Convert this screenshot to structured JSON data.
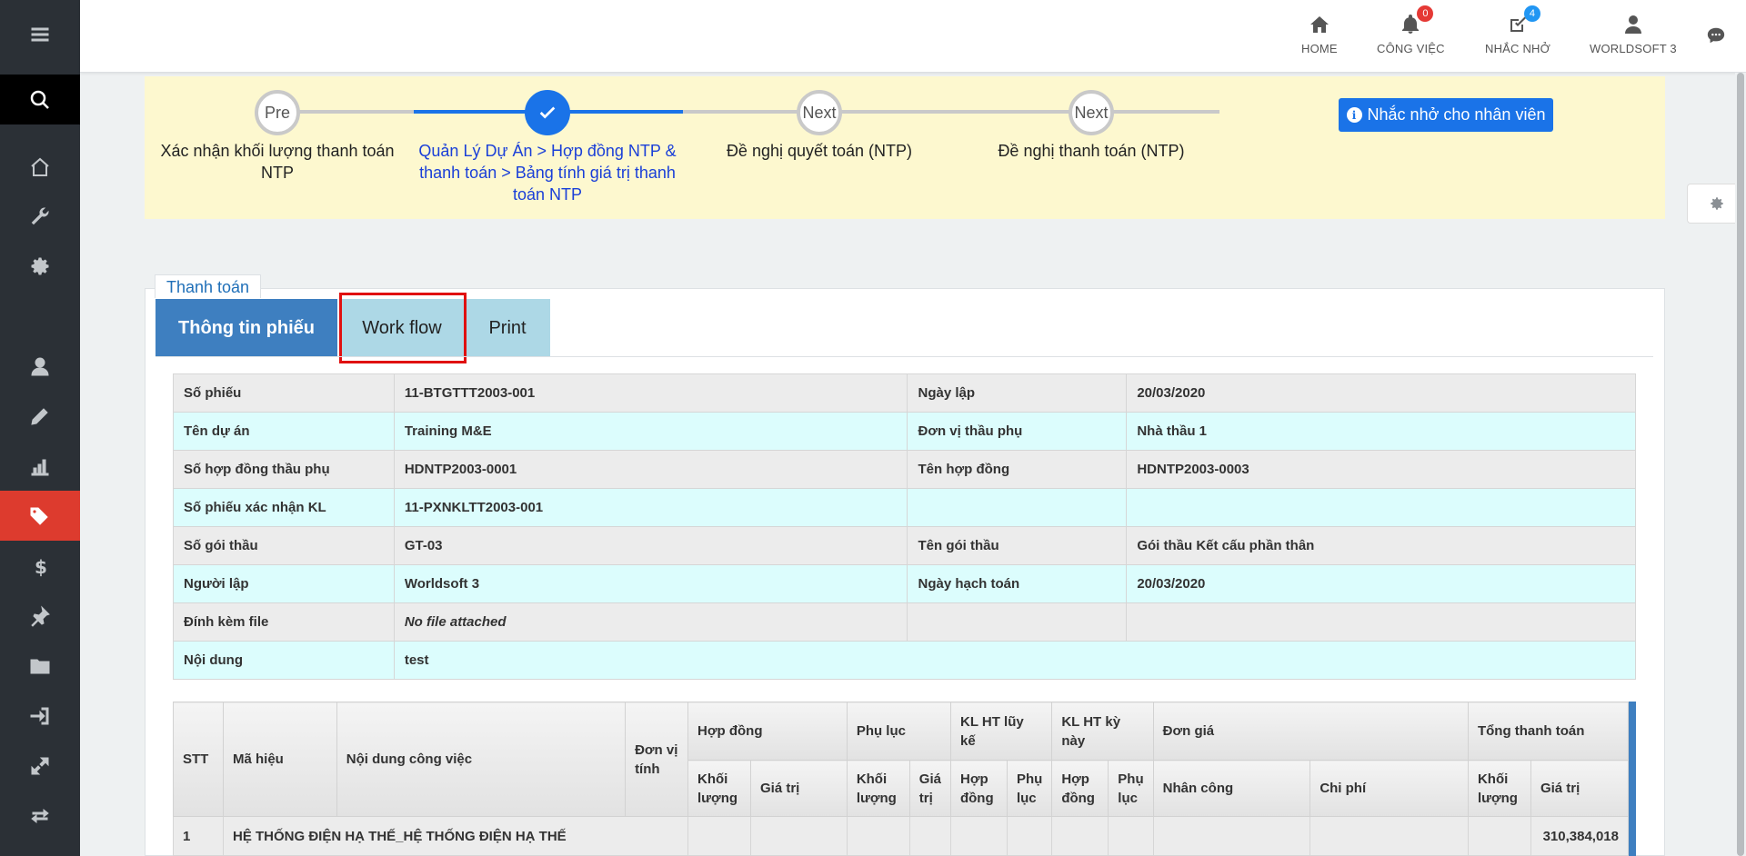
{
  "topbar": {
    "home": "HOME",
    "tasks": "CÔNG VIỆC",
    "tasks_badge": "0",
    "reminders": "NHẮC NHỞ",
    "reminders_badge": "4",
    "user": "WORLDSOFT 3"
  },
  "sidebar_icons": [
    "menu-icon",
    "search-icon",
    "home-icon",
    "wrench-icon",
    "gear-icon",
    "user-icon",
    "pencil-icon",
    "bar-chart-icon",
    "tags-icon",
    "dollar-icon",
    "pin-icon",
    "folder-icon",
    "sign-in-icon",
    "expand-icon",
    "exchange-icon"
  ],
  "workflow": {
    "steps": [
      {
        "node": "Pre",
        "label": "Xác nhận khối lượng thanh toán NTP"
      },
      {
        "node": "",
        "label": "Quản Lý Dự Án > Hợp đồng NTP & thanh toán > Bảng tính giá trị thanh toán NTP"
      },
      {
        "node": "Next",
        "label": "Đề nghị quyết toán (NTP)"
      },
      {
        "node": "Next",
        "label": "Đề nghị thanh toán (NTP)"
      }
    ],
    "remind_button": "Nhắc nhở cho nhân viên"
  },
  "panel": {
    "legend": "Thanh toán",
    "tabs": [
      "Thông tin phiếu",
      "Work flow",
      "Print"
    ]
  },
  "info": {
    "rows": [
      [
        "Số phiếu",
        "11-BTGTTT2003-001",
        "Ngày lập",
        "20/03/2020"
      ],
      [
        "Tên dự án",
        "Training M&E",
        "Đơn vị thầu phụ",
        "Nhà thầu 1"
      ],
      [
        "Số hợp đồng thầu phụ",
        "HDNTP2003-0001",
        "Tên hợp đồng",
        "HDNTP2003-0003"
      ],
      [
        "Số phiếu xác nhận KL",
        "11-PXNKLTT2003-001",
        "",
        ""
      ],
      [
        "Số gói thầu",
        "GT-03",
        "Tên gói thầu",
        "Gói thầu Kết cấu phần thân"
      ],
      [
        "Người lập",
        "Worldsoft 3",
        "Ngày hạch toán",
        "20/03/2020"
      ],
      [
        "Đính kèm file",
        "No file attached",
        "",
        ""
      ],
      [
        "Nội dung",
        "test"
      ]
    ]
  },
  "detail": {
    "headers": {
      "stt": "STT",
      "ma_hieu": "Mã hiệu",
      "noi_dung": "Nội dung công việc",
      "don_vi": "Đơn vị tính",
      "hop_dong": "Hợp đồng",
      "phu_luc": "Phụ lục",
      "kl_luy_ke": "KL HT lũy kế",
      "kl_ky_nay": "KL HT kỳ này",
      "don_gia": "Đơn giá",
      "tong_tt": "Tổng thanh toán",
      "khoi_luong": "Khối lượng",
      "gia_tri": "Giá trị",
      "gia_tri_short": "Giá trị",
      "hop_dong_sub": "Hợp đồng",
      "phu_luc_sub": "Phụ lục",
      "nhan_cong": "Nhân công",
      "chi_phi": "Chi phí"
    },
    "rows": [
      {
        "stt": "1",
        "content": "HỆ THỐNG ĐIỆN HẠ THẾ_HỆ THỐNG ĐIỆN HẠ THẾ",
        "total": "310,384,018"
      }
    ]
  }
}
